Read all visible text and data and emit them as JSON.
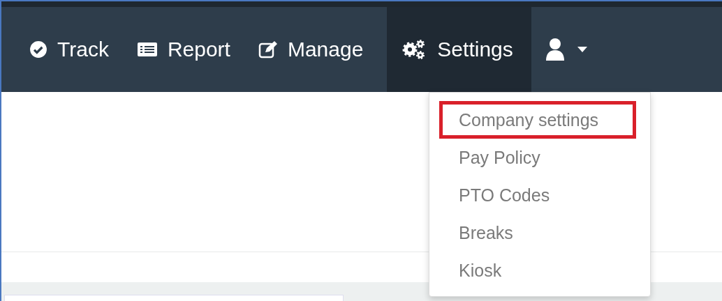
{
  "navbar": {
    "items": [
      {
        "label": "Track",
        "selected": false
      },
      {
        "label": "Report",
        "selected": false
      },
      {
        "label": "Manage",
        "selected": false
      },
      {
        "label": "Settings",
        "selected": true
      }
    ]
  },
  "dropdown": {
    "items": [
      {
        "label": "Company settings",
        "highlighted": true
      },
      {
        "label": "Pay Policy",
        "highlighted": false
      },
      {
        "label": "PTO Codes",
        "highlighted": false
      },
      {
        "label": "Breaks",
        "highlighted": false
      },
      {
        "label": "Kiosk",
        "highlighted": false
      }
    ]
  }
}
